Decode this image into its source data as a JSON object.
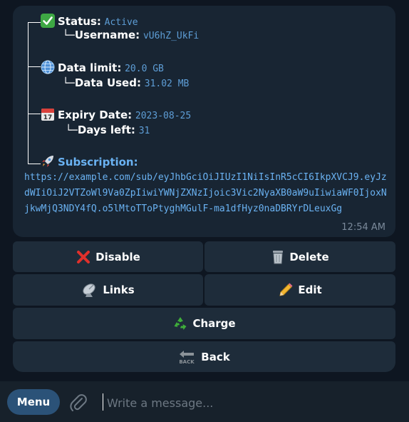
{
  "message": {
    "status_label": "Status:",
    "status_value": "Active",
    "username_label": "Username:",
    "username_value": "vU6hZ_UkFi",
    "data_limit_label": "Data limit:",
    "data_limit_value": "20.0 GB",
    "data_used_label": "Data Used:",
    "data_used_value": "31.02 MB",
    "expiry_label": "Expiry Date:",
    "expiry_value": "2023-08-25",
    "days_left_label": "Days left:",
    "days_left_value": "31",
    "subscription_label": "Subscription:",
    "subscription_link": "https://example.com/sub/eyJhbGciOiJIUzI1NiIsInR5cCI6IkpXVCJ9.eyJzdWIiOiJ2VTZoWl9Va0ZpIiwiYWNjZXNzIjoic3Vic2NyaXB0aW9uIiwiaWF0IjoxNjkwMjQ3NDY4fQ.o5lMtoTToPtyghMGulF-ma1dfHyz0naDBRYrDLeuxGg",
    "time": "12:54 AM",
    "icons": {
      "status": "check-mark-icon",
      "data_limit": "globe-icon",
      "expiry": "calendar-icon",
      "subscription": "rocket-icon"
    },
    "calendar_day": "17"
  },
  "keyboard": {
    "disable_label": "Disable",
    "delete_label": "Delete",
    "links_label": "Links",
    "edit_label": "Edit",
    "charge_label": "Charge",
    "back_label": "Back",
    "back_icon_text": "BACK"
  },
  "composer": {
    "menu_label": "Menu",
    "placeholder": "Write a message..."
  },
  "colors": {
    "background": "#0e1621",
    "bubble": "#182533",
    "button": "#1e2c3a",
    "accent": "#6ab2f2",
    "menu_button": "#2b5278"
  }
}
